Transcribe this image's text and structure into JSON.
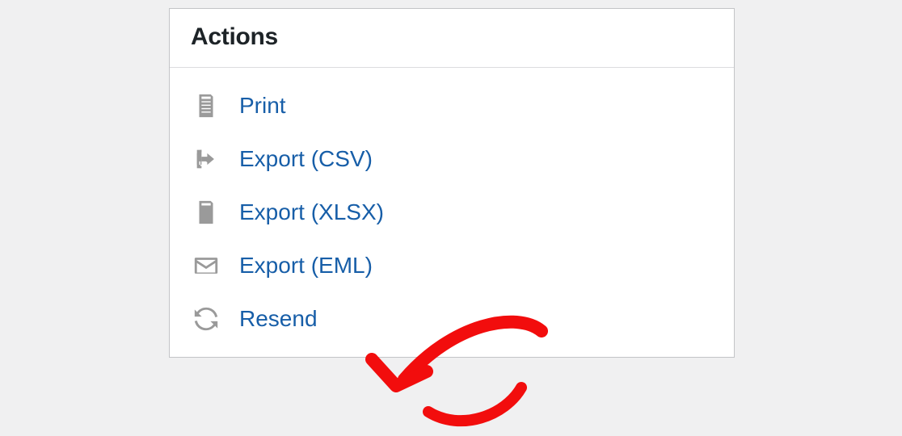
{
  "panel": {
    "title": "Actions",
    "items": [
      {
        "label": "Print"
      },
      {
        "label": "Export (CSV)"
      },
      {
        "label": "Export (XLSX)"
      },
      {
        "label": "Export (EML)"
      },
      {
        "label": "Resend"
      }
    ]
  }
}
